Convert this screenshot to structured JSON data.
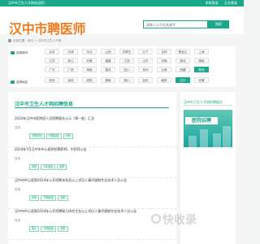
{
  "topbar": {
    "title": "汉中市卫生人才网欢迎您！",
    "links": [
      "求职登录",
      "企业登录"
    ]
  },
  "header": {
    "logo": "汉中市聘医师",
    "search_placeholder": "请输入公司名关键字",
    "search_button": "搜索"
  },
  "breadcrumb": "当前位置：首页 > 汉中市卫生人才网",
  "filters": [
    {
      "label": "选择城市",
      "options": [
        [
          "北京",
          "天津",
          "河北",
          "山西",
          "内蒙古",
          "辽宁",
          "吉林",
          "黑龙江",
          "上海"
        ],
        [
          "江苏",
          "浙江",
          "安徽",
          "福建",
          "江西",
          "山东",
          "河南",
          "湖北",
          "湖南"
        ],
        [
          "广东",
          "广西",
          "海南",
          "重庆",
          "四川",
          "贵州",
          "云南",
          "西藏",
          "陕西"
        ]
      ],
      "active": "陕西"
    },
    {
      "label": "选择地区",
      "options": [
        [
          "西安",
          "宝鸡",
          "咸阳",
          "渭南",
          "铜川",
          "延安",
          "榆林",
          "汉中",
          "安康"
        ]
      ],
      "active": "汉中"
    }
  ],
  "main": {
    "title": "汉中市卫生人才网招聘信息",
    "items": [
      {
        "title": "2024年汉中市医院招人员招聘报名公示（第一批）汇总",
        "loc": "汉中",
        "tags": [
          "不限学历",
          "不限经验",
          "全职"
        ]
      },
      {
        "title": "2024年7月汉中市中心医院招聘药师、中药师公告",
        "loc": "汉中",
        "tags": [
          "本科",
          "1年经验",
          "全职"
        ]
      },
      {
        "title": "汉中市中心医院2024年公开招聘本科及以上学历人事代理制专业技术人员公告",
        "loc": "汉中",
        "tags": [
          "本科",
          "不限经验",
          "全职"
        ]
      },
      {
        "title": "汉中市中心医院2024年公开招聘硕士研究生及以上学历人事代理制专业技术人员公告",
        "loc": "汉中",
        "tags": [
          "硕士",
          "不限经验",
          "全职"
        ]
      }
    ]
  },
  "side": {
    "title": "汉中市卫生人才网招聘图文",
    "banner_text": "医院招聘"
  },
  "watermark": "快收录"
}
